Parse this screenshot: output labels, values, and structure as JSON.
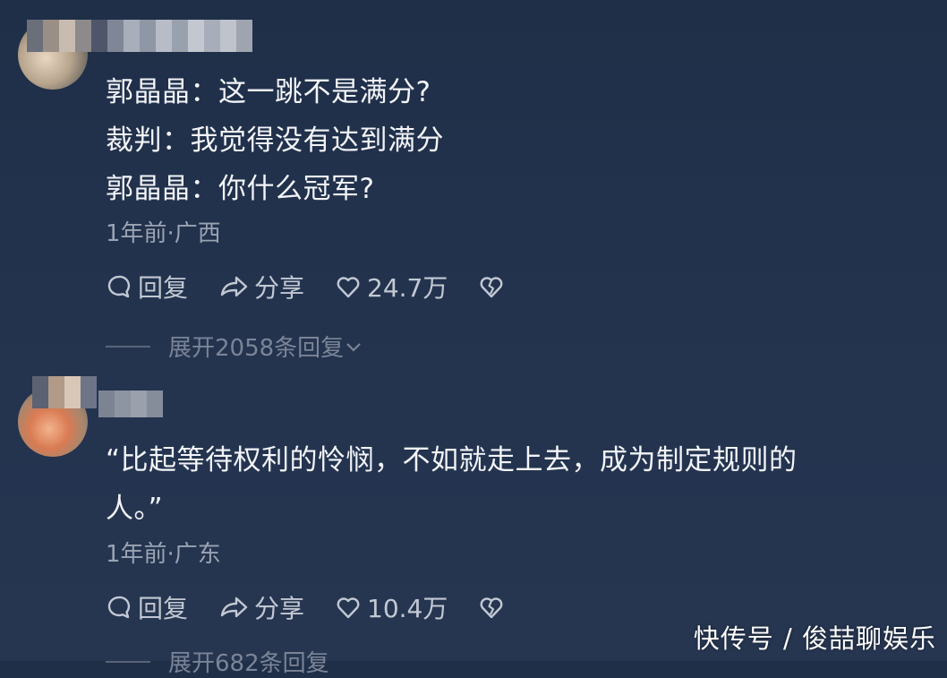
{
  "comments": [
    {
      "lines": [
        "郭晶晶：这一跳不是满分?",
        "裁判：我觉得没有达到满分",
        "郭晶晶：你什么冠军?"
      ],
      "meta": "1年前·广西",
      "reply_label": "回复",
      "share_label": "分享",
      "likes": "24.7万",
      "expand_label": "展开2058条回复"
    },
    {
      "lines": [
        "“比起等待权利的怜悯，不如就走上去，成为制定规则的",
        "人。”"
      ],
      "meta": "1年前·广东",
      "reply_label": "回复",
      "share_label": "分享",
      "likes": "10.4万",
      "expand_label": "展开682条回复"
    }
  ],
  "watermark": "快传号 / 俊喆聊娱乐",
  "icons": [
    "comment-icon",
    "share-icon",
    "heart-icon",
    "broken-heart-icon",
    "chevron-down-icon"
  ],
  "colors": {
    "background": "#23334e",
    "text": "#f2f4f8",
    "meta": "#9aa3b3"
  }
}
